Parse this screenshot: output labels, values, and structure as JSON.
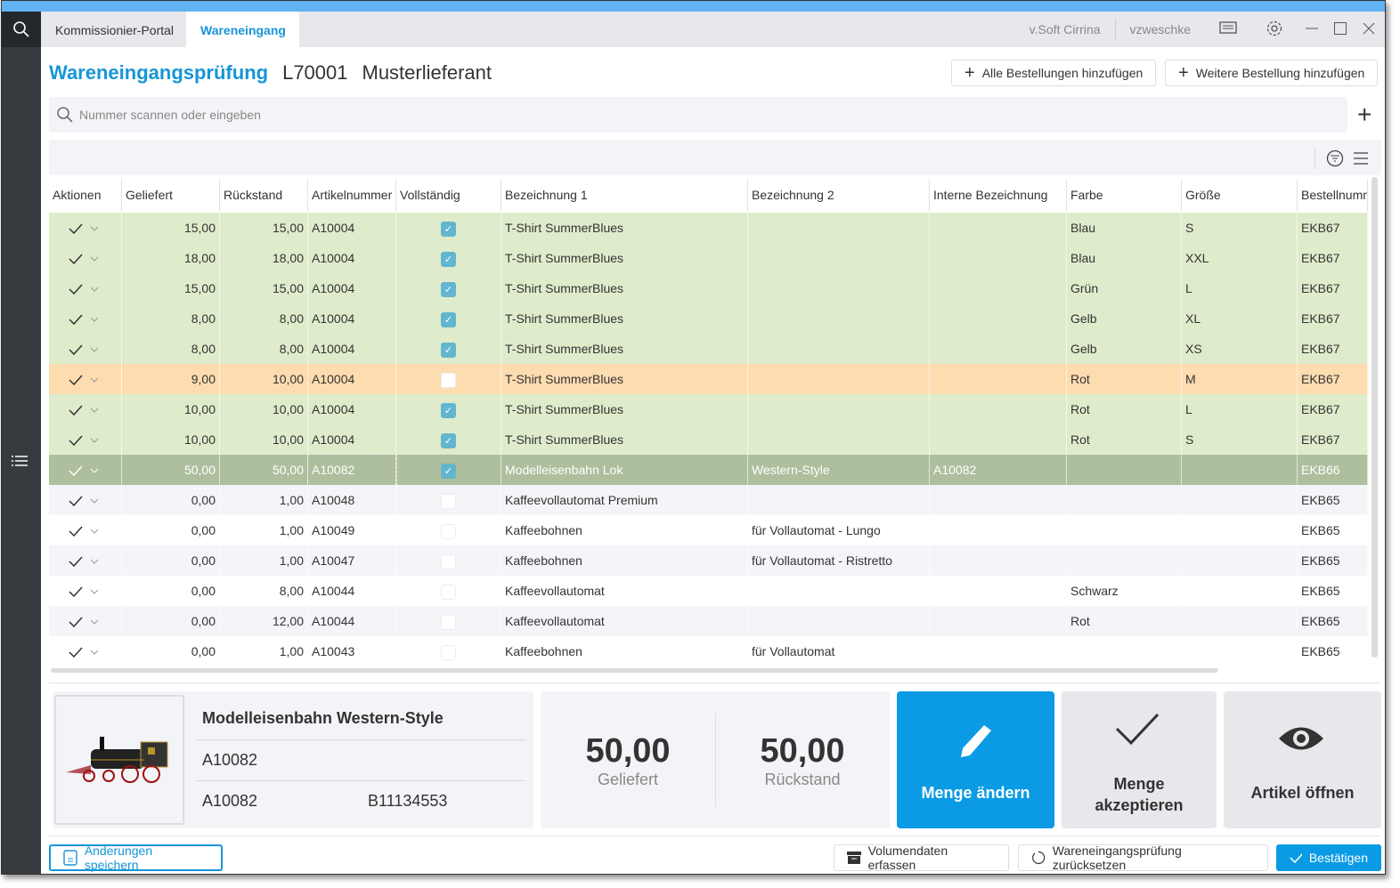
{
  "tabs": {
    "items": [
      {
        "label": "Kommissionier-Portal"
      },
      {
        "label": "Wareneingang"
      }
    ],
    "app": "v.Soft Cirrina",
    "user": "vzweschke"
  },
  "header": {
    "title": "Wareneingangsprüfung",
    "supplier_id": "L70001",
    "supplier_name": "Musterlieferant",
    "add_all": "Alle Bestellungen hinzufügen",
    "add_more": "Weitere Bestellung hinzufügen"
  },
  "search": {
    "placeholder": "Nummer scannen oder eingeben"
  },
  "colors": {
    "accent": "#1795d8",
    "complete": "#dfeccb",
    "partial": "#fddcb0",
    "selected": "#aebf9e"
  },
  "table": {
    "columns": [
      "Aktionen",
      "Geliefert",
      "Rückstand",
      "Artikelnummer",
      "Vollständig",
      "Bezeichnung  1",
      "Bezeichnung  2",
      "Interne  Bezeichnung",
      "Farbe",
      "Größe",
      "Bestellnumm"
    ],
    "rows": [
      {
        "geliefert": "15,00",
        "rueckstand": "15,00",
        "artikel": "A10004",
        "complete": true,
        "bez1": "T-Shirt SummerBlues",
        "bez2": "",
        "intern": "",
        "farbe": "Blau",
        "groesse": "S",
        "bestell": "EKB67",
        "state": "complete"
      },
      {
        "geliefert": "18,00",
        "rueckstand": "18,00",
        "artikel": "A10004",
        "complete": true,
        "bez1": "T-Shirt SummerBlues",
        "bez2": "",
        "intern": "",
        "farbe": "Blau",
        "groesse": "XXL",
        "bestell": "EKB67",
        "state": "complete"
      },
      {
        "geliefert": "15,00",
        "rueckstand": "15,00",
        "artikel": "A10004",
        "complete": true,
        "bez1": "T-Shirt SummerBlues",
        "bez2": "",
        "intern": "",
        "farbe": "Grün",
        "groesse": "L",
        "bestell": "EKB67",
        "state": "complete"
      },
      {
        "geliefert": "8,00",
        "rueckstand": "8,00",
        "artikel": "A10004",
        "complete": true,
        "bez1": "T-Shirt SummerBlues",
        "bez2": "",
        "intern": "",
        "farbe": "Gelb",
        "groesse": "XL",
        "bestell": "EKB67",
        "state": "complete"
      },
      {
        "geliefert": "8,00",
        "rueckstand": "8,00",
        "artikel": "A10004",
        "complete": true,
        "bez1": "T-Shirt SummerBlues",
        "bez2": "",
        "intern": "",
        "farbe": "Gelb",
        "groesse": "XS",
        "bestell": "EKB67",
        "state": "complete"
      },
      {
        "geliefert": "9,00",
        "rueckstand": "10,00",
        "artikel": "A10004",
        "complete": false,
        "bez1": "T-Shirt SummerBlues",
        "bez2": "",
        "intern": "",
        "farbe": "Rot",
        "groesse": "M",
        "bestell": "EKB67",
        "state": "partial"
      },
      {
        "geliefert": "10,00",
        "rueckstand": "10,00",
        "artikel": "A10004",
        "complete": true,
        "bez1": "T-Shirt SummerBlues",
        "bez2": "",
        "intern": "",
        "farbe": "Rot",
        "groesse": "L",
        "bestell": "EKB67",
        "state": "complete"
      },
      {
        "geliefert": "10,00",
        "rueckstand": "10,00",
        "artikel": "A10004",
        "complete": true,
        "bez1": "T-Shirt SummerBlues",
        "bez2": "",
        "intern": "",
        "farbe": "Rot",
        "groesse": "S",
        "bestell": "EKB67",
        "state": "complete"
      },
      {
        "geliefert": "50,00",
        "rueckstand": "50,00",
        "artikel": "A10082",
        "complete": true,
        "bez1": "Modelleisenbahn Lok",
        "bez2": "Western-Style",
        "intern": "A10082",
        "farbe": "",
        "groesse": "",
        "bestell": "EKB66",
        "state": "selected"
      },
      {
        "geliefert": "0,00",
        "rueckstand": "1,00",
        "artikel": "A10048",
        "complete": false,
        "bez1": "Kaffeevollautomat Premium",
        "bez2": "",
        "intern": "",
        "farbe": "",
        "groesse": "",
        "bestell": "EKB65",
        "state": "none"
      },
      {
        "geliefert": "0,00",
        "rueckstand": "1,00",
        "artikel": "A10049",
        "complete": false,
        "bez1": "Kaffeebohnen",
        "bez2": "für Vollautomat - Lungo",
        "intern": "",
        "farbe": "",
        "groesse": "",
        "bestell": "EKB65",
        "state": "none"
      },
      {
        "geliefert": "0,00",
        "rueckstand": "1,00",
        "artikel": "A10047",
        "complete": false,
        "bez1": "Kaffeebohnen",
        "bez2": "für Vollautomat - Ristretto",
        "intern": "",
        "farbe": "",
        "groesse": "",
        "bestell": "EKB65",
        "state": "none"
      },
      {
        "geliefert": "0,00",
        "rueckstand": "8,00",
        "artikel": "A10044",
        "complete": false,
        "bez1": "Kaffeevollautomat",
        "bez2": "",
        "intern": "",
        "farbe": "Schwarz",
        "groesse": "",
        "bestell": "EKB65",
        "state": "none"
      },
      {
        "geliefert": "0,00",
        "rueckstand": "12,00",
        "artikel": "A10044",
        "complete": false,
        "bez1": "Kaffeevollautomat",
        "bez2": "",
        "intern": "",
        "farbe": "Rot",
        "groesse": "",
        "bestell": "EKB65",
        "state": "none"
      },
      {
        "geliefert": "0,00",
        "rueckstand": "1,00",
        "artikel": "A10043",
        "complete": false,
        "bez1": "Kaffeebohnen",
        "bez2": "für Vollautomat",
        "intern": "",
        "farbe": "",
        "groesse": "",
        "bestell": "EKB65",
        "state": "none"
      }
    ]
  },
  "detail": {
    "name": "Modelleisenbahn Western-Style",
    "artikel": "A10082",
    "artikel2": "A10082",
    "code": "B11134553",
    "geliefert": "50,00",
    "geliefert_label": "Geliefert",
    "rueckstand": "50,00",
    "rueckstand_label": "Rückstand"
  },
  "actions": {
    "change": "Menge ändern",
    "accept": "Menge akzeptieren",
    "open": "Artikel öffnen"
  },
  "footer": {
    "save": "Änderungen speichern",
    "volume": "Volumendaten erfassen",
    "reset": "Wareneingangsprüfung zurücksetzen",
    "confirm": "Bestätigen"
  }
}
